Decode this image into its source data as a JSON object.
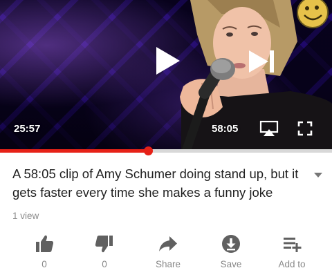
{
  "player": {
    "current_time": "25:57",
    "duration": "58:05",
    "progress_fraction": 0.447,
    "colors": {
      "progress": "#e62117",
      "track": "#d8d8d8",
      "backdrop": "#2a1350"
    }
  },
  "video": {
    "title": "A 58:05 clip of Amy Schumer doing stand up, but it gets faster every time she makes a funny joke",
    "views": "1 view"
  },
  "actions": [
    {
      "icon": "thumbs-up-icon",
      "label": "0"
    },
    {
      "icon": "thumbs-down-icon",
      "label": "0"
    },
    {
      "icon": "share-icon",
      "label": "Share"
    },
    {
      "icon": "save-icon",
      "label": "Save"
    },
    {
      "icon": "add-to-playlist-icon",
      "label": "Add to"
    }
  ]
}
